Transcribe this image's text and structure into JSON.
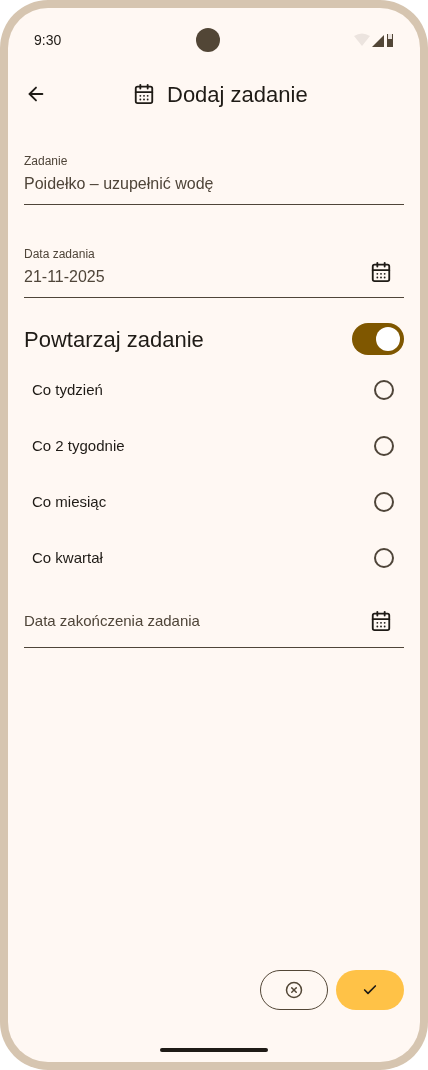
{
  "status_bar": {
    "time": "9:30"
  },
  "header": {
    "title": "Dodaj zadanie"
  },
  "task_field": {
    "label": "Zadanie",
    "value": "Poidełko – uzupełnić wodę"
  },
  "date_field": {
    "label": "Data zadania",
    "value": "21-11-2025"
  },
  "repeat": {
    "label": "Powtarzaj zadanie",
    "on": true
  },
  "options": [
    {
      "label": "Co tydzień",
      "selected": false
    },
    {
      "label": "Co 2 tygodnie",
      "selected": false
    },
    {
      "label": "Co miesiąc",
      "selected": false
    },
    {
      "label": "Co kwartał",
      "selected": false
    }
  ],
  "end_date_field": {
    "placeholder": "Data zakończenia zadania"
  }
}
